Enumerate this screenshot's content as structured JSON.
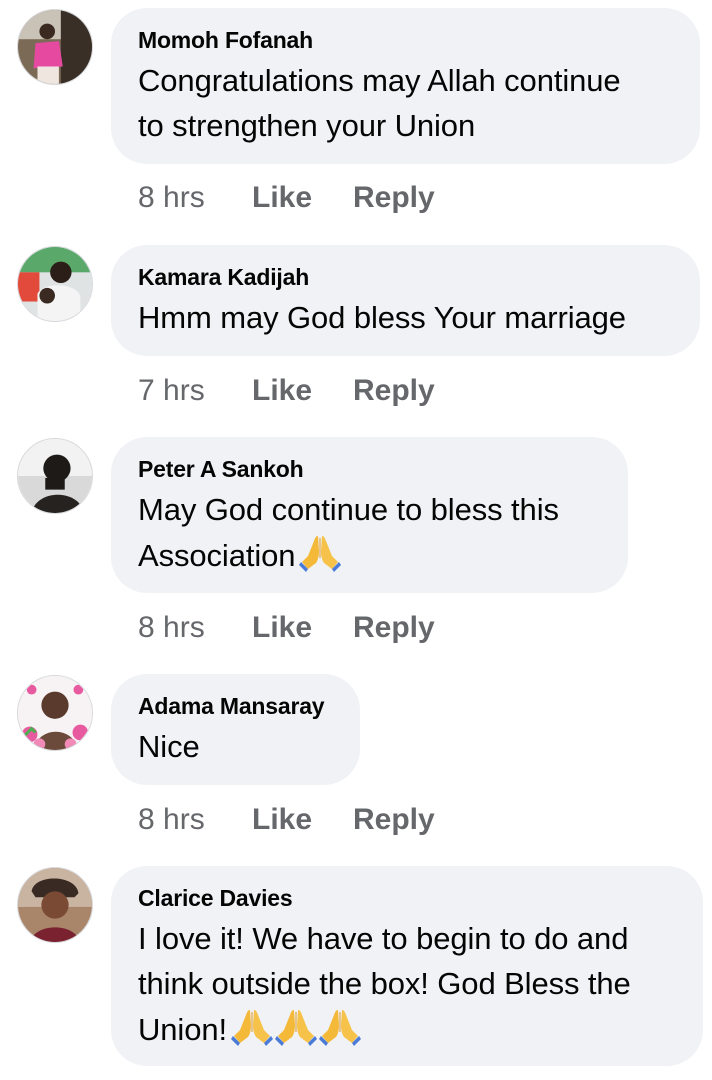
{
  "comments": [
    {
      "author": "Momoh Fofanah",
      "text_lines": [
        "Congratulations may Allah continue",
        "to strengthen your Union"
      ],
      "time": "8 hrs",
      "like_label": "Like",
      "reply_label": "Reply"
    },
    {
      "author": "Kamara Kadijah",
      "text_lines": [
        "Hmm may God bless Your marriage"
      ],
      "time": "7 hrs",
      "like_label": "Like",
      "reply_label": "Reply"
    },
    {
      "author": "Peter A Sankoh",
      "text_lines": [
        "May God continue to bless this",
        "Association"
      ],
      "time": "8 hrs",
      "like_label": "Like",
      "reply_label": "Reply"
    },
    {
      "author": "Adama Mansaray",
      "text_lines": [
        "Nice"
      ],
      "time": "8 hrs",
      "like_label": "Like",
      "reply_label": "Reply"
    },
    {
      "author": "Clarice Davies",
      "text_lines": [
        "I love it! We have to begin to do and",
        "think outside the box! God Bless the",
        "Union!"
      ],
      "time": "",
      "like_label": "",
      "reply_label": ""
    }
  ],
  "icons": {
    "emoji": "folded-hands-icon"
  },
  "colors": {
    "bubble": "#f0f2f5",
    "meta_text": "#65676b",
    "primary_text": "#050505",
    "emoji": "#f5b93a"
  }
}
